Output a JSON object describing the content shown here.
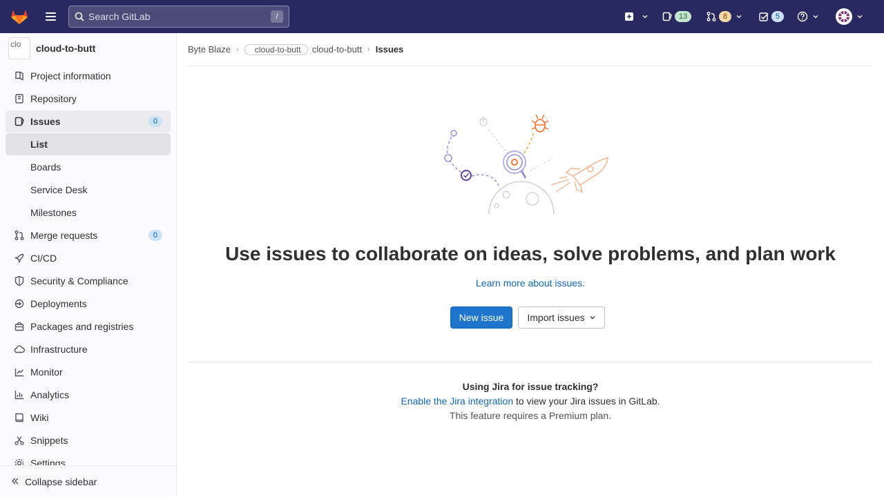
{
  "topbar": {
    "search_placeholder": "Search GitLab",
    "search_shortcut": "/",
    "issues_count": "13",
    "mr_count": "8",
    "todo_count": "5",
    "colors": {
      "bg": "#292961",
      "issues_badge": "#c3e6cd",
      "mr_badge": "#f5d9a8",
      "todo_badge": "#cbe2f9"
    }
  },
  "sidebar": {
    "project_avatar_alt": "clo",
    "project_name": "cloud-to-butt",
    "items": [
      {
        "label": "Project information",
        "icon": "project-info-icon"
      },
      {
        "label": "Repository",
        "icon": "repository-icon"
      },
      {
        "label": "Issues",
        "icon": "issues-icon",
        "count": "0"
      },
      {
        "label": "List"
      },
      {
        "label": "Boards"
      },
      {
        "label": "Service Desk"
      },
      {
        "label": "Milestones"
      },
      {
        "label": "Merge requests",
        "icon": "merge-request-icon",
        "count": "0"
      },
      {
        "label": "CI/CD",
        "icon": "rocket-icon"
      },
      {
        "label": "Security & Compliance",
        "icon": "shield-icon"
      },
      {
        "label": "Deployments",
        "icon": "deployments-icon"
      },
      {
        "label": "Packages and registries",
        "icon": "package-icon"
      },
      {
        "label": "Infrastructure",
        "icon": "cloud-icon"
      },
      {
        "label": "Monitor",
        "icon": "monitor-icon"
      },
      {
        "label": "Analytics",
        "icon": "chart-icon"
      },
      {
        "label": "Wiki",
        "icon": "book-icon"
      },
      {
        "label": "Snippets",
        "icon": "snippet-icon"
      },
      {
        "label": "Settings",
        "icon": "settings-icon"
      }
    ],
    "collapse_label": "Collapse sidebar"
  },
  "breadcrumb": {
    "group": "Byte Blaze",
    "project_img_alt": "cloud-to-butt",
    "project": "cloud-to-butt",
    "current": "Issues"
  },
  "empty_state": {
    "title": "Use issues to collaborate on ideas, solve problems, and plan work",
    "learn_more": "Learn more about issues.",
    "new_issue": "New issue",
    "import_issues": "Import issues"
  },
  "jira": {
    "title": "Using Jira for issue tracking?",
    "link": "Enable the Jira integration",
    "text": " to view your Jira issues in GitLab.",
    "note": "This feature requires a Premium plan."
  }
}
